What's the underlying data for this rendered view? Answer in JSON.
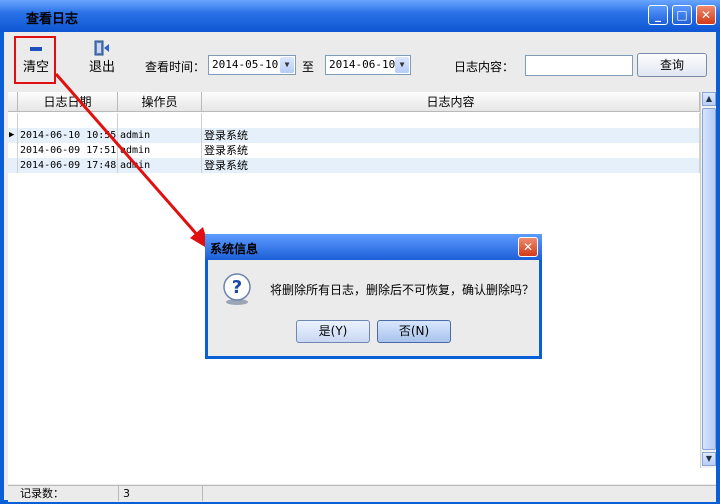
{
  "window": {
    "title": "查看日志",
    "minimize": "_",
    "maximize": "□",
    "close": "✕"
  },
  "toolbar": {
    "clear_label": "清空",
    "exit_label": "退出"
  },
  "filter": {
    "time_label": "查看时间：",
    "start_date": "2014-05-10",
    "to_label": "至",
    "end_date": "2014-06-10",
    "content_label": "日志内容：",
    "content_value": "",
    "query_label": "查询"
  },
  "table": {
    "headers": [
      "日志日期",
      "操作员",
      "日志内容"
    ],
    "rows": [
      {
        "date": "2014-06-10 10:55",
        "operator": "admin",
        "content": "登录系统"
      },
      {
        "date": "2014-06-09 17:51",
        "operator": "admin",
        "content": "登录系统"
      },
      {
        "date": "2014-06-09 17:48",
        "operator": "admin",
        "content": "登录系统"
      }
    ]
  },
  "footer": {
    "count_label": "记录数：",
    "count_value": "3"
  },
  "dialog": {
    "title": "系统信息",
    "close": "✕",
    "message": "将删除所有日志，删除后不可恢复，确认删除吗？",
    "yes_label": "是(Y)",
    "no_label": "否(N)",
    "icon": "question-icon"
  },
  "colors": {
    "titlebar": "#0d55d2",
    "highlight": "#e01010",
    "row_selected": "#e6f0fb"
  }
}
